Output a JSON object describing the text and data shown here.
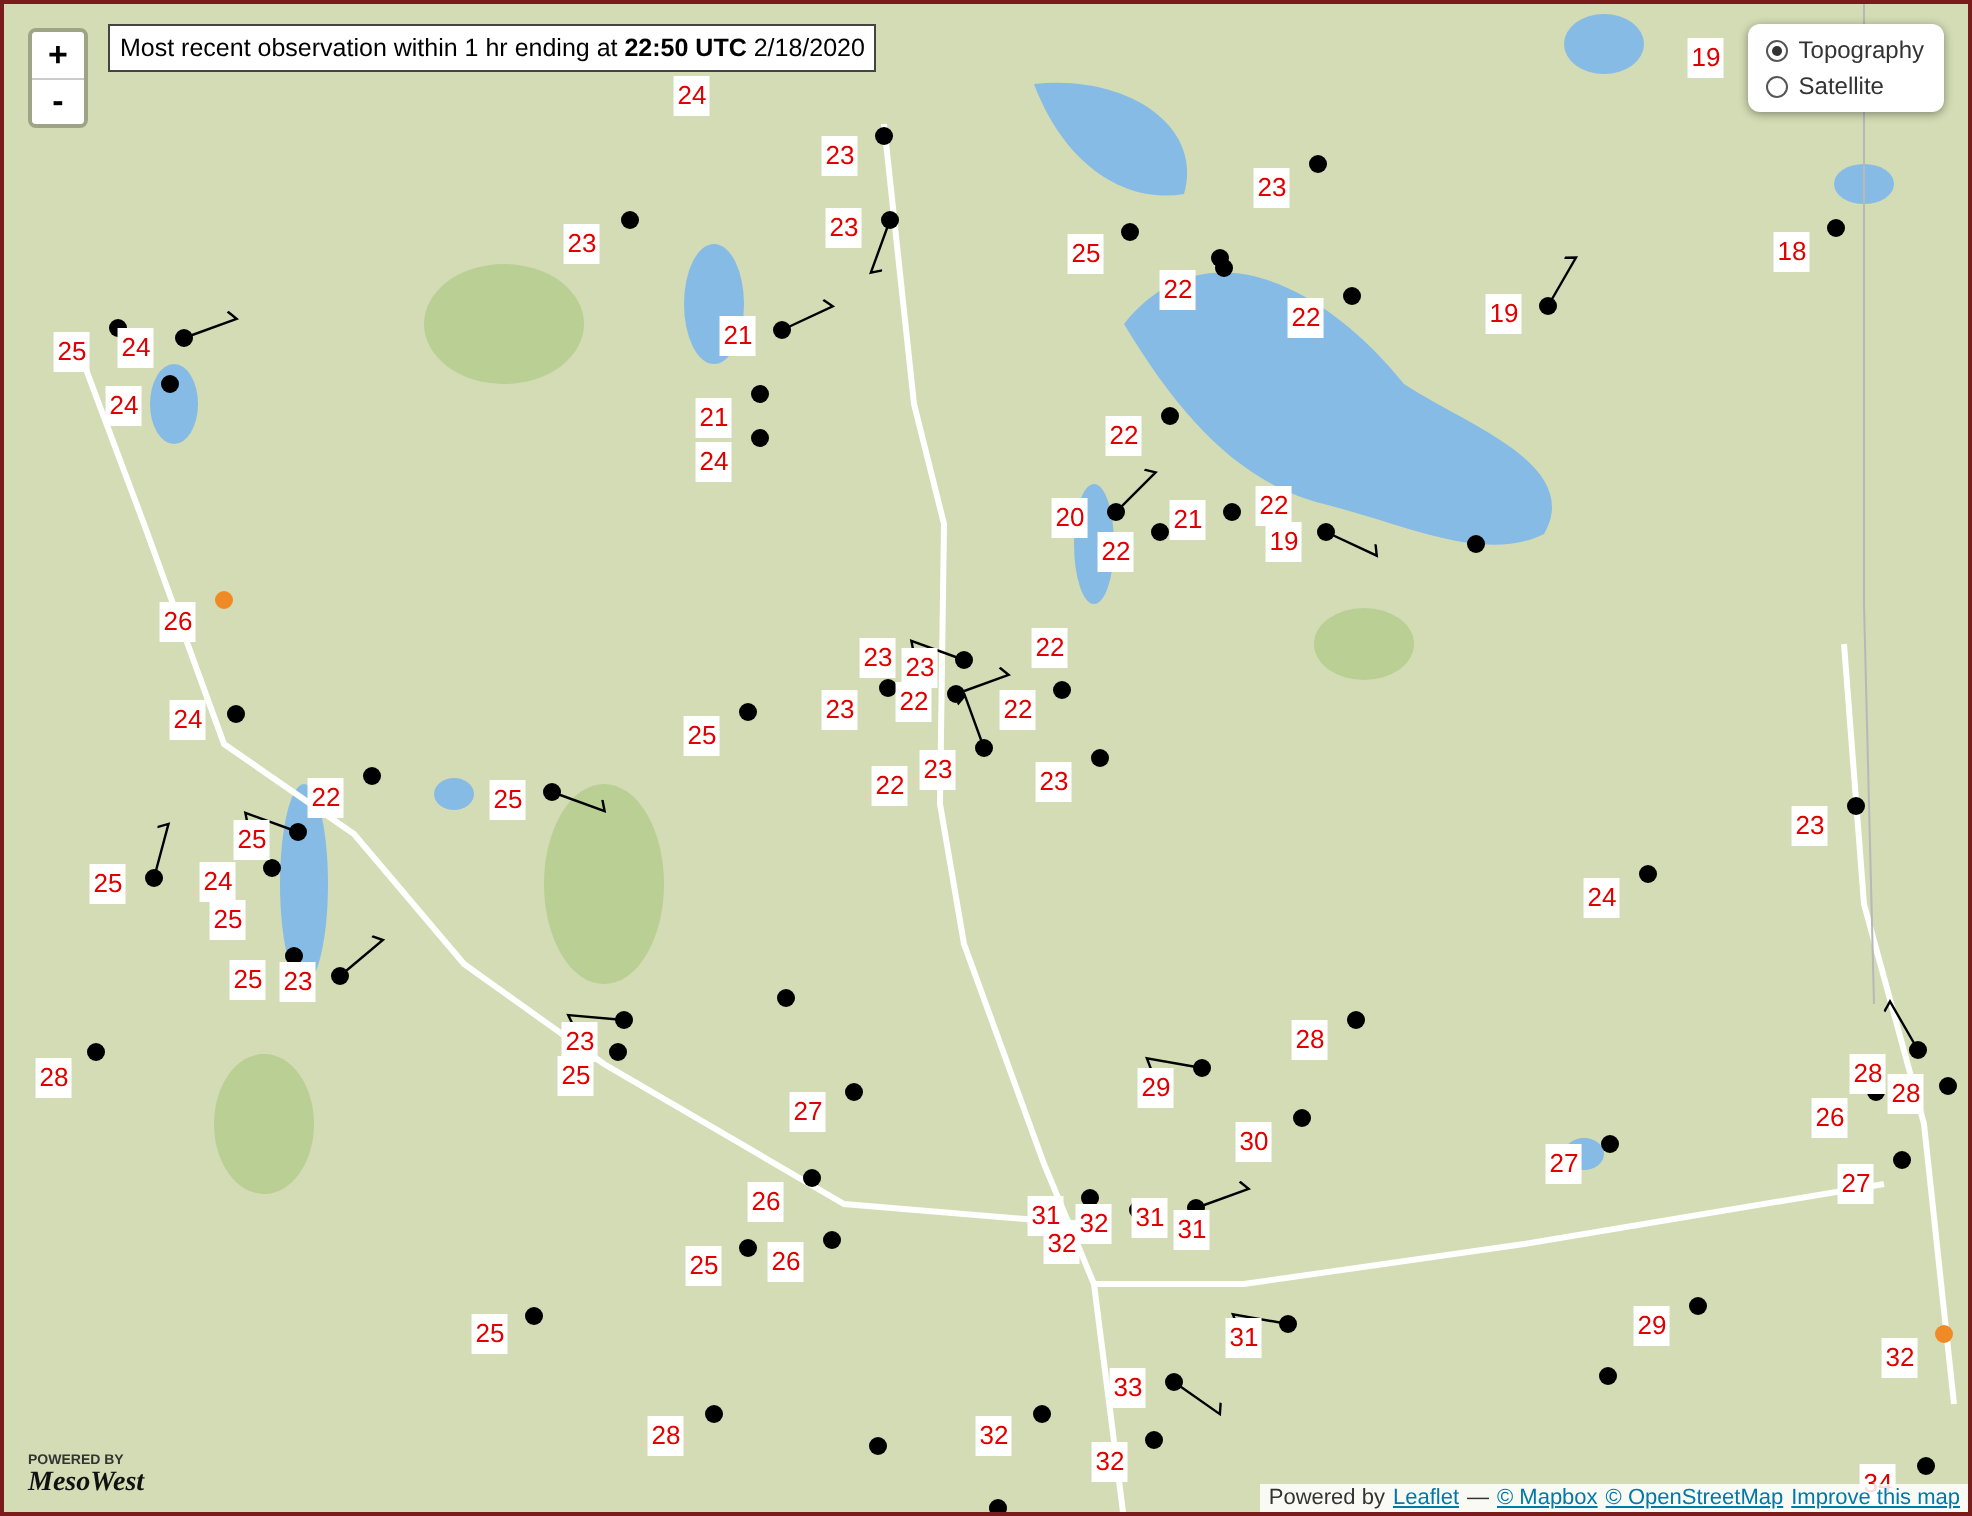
{
  "map": {
    "zoom_controls": [
      {
        "label": "+"
      },
      {
        "label": "-"
      }
    ],
    "caption": "Most recent observation within 1 hr ending at **22:50 UTC** 2/18/2020",
    "layers": [
      {
        "label": "Topography",
        "selected": true
      },
      {
        "label": "Satellite",
        "selected": false
      }
    ],
    "temperature_labels": [
      {
        "value": "24"
      },
      {
        "value": "23"
      },
      {
        "value": "23"
      },
      {
        "value": "23"
      },
      {
        "value": "25"
      },
      {
        "value": "23"
      },
      {
        "value": "19"
      },
      {
        "value": "18"
      },
      {
        "value": "22"
      },
      {
        "value": "22"
      },
      {
        "value": "19"
      },
      {
        "value": "21"
      },
      {
        "value": "25"
      },
      {
        "value": "24"
      },
      {
        "value": "24"
      },
      {
        "value": "21"
      },
      {
        "value": "24"
      },
      {
        "value": "22"
      },
      {
        "value": "20"
      },
      {
        "value": "22"
      },
      {
        "value": "21"
      },
      {
        "value": "22"
      },
      {
        "value": "19"
      },
      {
        "value": "26"
      },
      {
        "value": "23"
      },
      {
        "value": "23"
      },
      {
        "value": "22"
      },
      {
        "value": "22"
      },
      {
        "value": "22"
      },
      {
        "value": "24"
      },
      {
        "value": "25"
      },
      {
        "value": "23"
      },
      {
        "value": "23"
      },
      {
        "value": "22"
      },
      {
        "value": "23"
      },
      {
        "value": "22"
      },
      {
        "value": "25"
      },
      {
        "value": "25"
      },
      {
        "value": "25"
      },
      {
        "value": "24"
      },
      {
        "value": "25"
      },
      {
        "value": "24"
      },
      {
        "value": "23"
      },
      {
        "value": "25"
      },
      {
        "value": "23"
      },
      {
        "value": "28"
      },
      {
        "value": "28"
      },
      {
        "value": "23"
      },
      {
        "value": "25"
      },
      {
        "value": "29"
      },
      {
        "value": "27"
      },
      {
        "value": "28"
      },
      {
        "value": "28"
      },
      {
        "value": "26"
      },
      {
        "value": "30"
      },
      {
        "value": "27"
      },
      {
        "value": "27"
      },
      {
        "value": "26"
      },
      {
        "value": "31"
      },
      {
        "value": "32"
      },
      {
        "value": "31"
      },
      {
        "value": "31"
      },
      {
        "value": "32"
      },
      {
        "value": "26"
      },
      {
        "value": "25"
      },
      {
        "value": "31"
      },
      {
        "value": "29"
      },
      {
        "value": "25"
      },
      {
        "value": "32"
      },
      {
        "value": "33"
      },
      {
        "value": "28"
      },
      {
        "value": "32"
      },
      {
        "value": "32"
      },
      {
        "value": "34"
      }
    ],
    "station_dots": [
      {
        "color": "#000000"
      },
      {
        "color": "#000000"
      },
      {
        "color": "#000000"
      },
      {
        "color": "#000000"
      },
      {
        "color": "#000000"
      },
      {
        "color": "#000000"
      },
      {
        "color": "#000000"
      },
      {
        "color": "#000000"
      },
      {
        "color": "#000000"
      },
      {
        "color": "#000000"
      },
      {
        "color": "#000000"
      },
      {
        "color": "#000000"
      },
      {
        "color": "#000000"
      },
      {
        "color": "#000000"
      },
      {
        "color": "#000000"
      },
      {
        "color": "#000000"
      },
      {
        "color": "#000000"
      },
      {
        "color": "#000000"
      },
      {
        "color": "#000000"
      },
      {
        "color": "#000000"
      },
      {
        "color": "#000000"
      },
      {
        "color": "#f08a24"
      },
      {
        "color": "#000000"
      },
      {
        "color": "#000000"
      },
      {
        "color": "#000000"
      },
      {
        "color": "#000000"
      },
      {
        "color": "#000000"
      },
      {
        "color": "#000000"
      },
      {
        "color": "#000000"
      },
      {
        "color": "#000000"
      },
      {
        "color": "#000000"
      },
      {
        "color": "#000000"
      },
      {
        "color": "#000000"
      },
      {
        "color": "#000000"
      },
      {
        "color": "#000000"
      },
      {
        "color": "#000000"
      },
      {
        "color": "#000000"
      },
      {
        "color": "#000000"
      },
      {
        "color": "#000000"
      },
      {
        "color": "#000000"
      },
      {
        "color": "#000000"
      },
      {
        "color": "#000000"
      },
      {
        "color": "#000000"
      },
      {
        "color": "#000000"
      },
      {
        "color": "#000000"
      },
      {
        "color": "#000000"
      },
      {
        "color": "#000000"
      },
      {
        "color": "#000000"
      },
      {
        "color": "#000000"
      },
      {
        "color": "#000000"
      },
      {
        "color": "#000000"
      },
      {
        "color": "#000000"
      },
      {
        "color": "#000000"
      },
      {
        "color": "#000000"
      },
      {
        "color": "#000000"
      },
      {
        "color": "#000000"
      },
      {
        "color": "#000000"
      },
      {
        "color": "#000000"
      },
      {
        "color": "#000000"
      },
      {
        "color": "#000000"
      },
      {
        "color": "#000000"
      },
      {
        "color": "#000000"
      },
      {
        "color": "#000000"
      },
      {
        "color": "#000000"
      },
      {
        "color": "#000000"
      },
      {
        "color": "#000000"
      },
      {
        "color": "#000000"
      },
      {
        "color": "#000000"
      },
      {
        "color": "#000000"
      },
      {
        "color": "#f08a24"
      },
      {
        "color": "#000000"
      }
    ],
    "logo": {
      "caption": "POWERED BY",
      "name": "MesoWest"
    },
    "attribution": [
      {
        "kind": "text",
        "text": "Powered by"
      },
      {
        "kind": "link",
        "text": "Leaflet"
      },
      {
        "kind": "text",
        "text": "—"
      },
      {
        "kind": "link",
        "text": "© Mapbox"
      },
      {
        "kind": "link",
        "text": "© OpenStreetMap"
      },
      {
        "kind": "link",
        "text": "Improve this map"
      }
    ]
  }
}
